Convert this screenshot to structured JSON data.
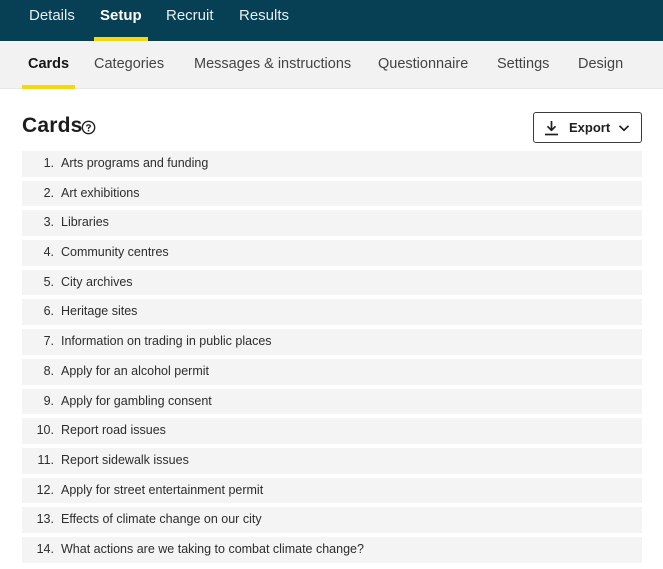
{
  "top_nav": {
    "tabs": [
      {
        "label": "Details"
      },
      {
        "label": "Setup"
      },
      {
        "label": "Recruit"
      },
      {
        "label": "Results"
      }
    ],
    "active": "Setup"
  },
  "sub_nav": {
    "tabs": [
      {
        "label": "Cards"
      },
      {
        "label": "Categories"
      },
      {
        "label": "Messages & instructions"
      },
      {
        "label": "Questionnaire"
      },
      {
        "label": "Settings"
      },
      {
        "label": "Design"
      }
    ],
    "active": "Cards"
  },
  "page": {
    "title": "Cards",
    "export_label": "Export"
  },
  "cards": [
    {
      "num": "1.",
      "text": "Arts programs and funding"
    },
    {
      "num": "2.",
      "text": "Art exhibitions"
    },
    {
      "num": "3.",
      "text": "Libraries"
    },
    {
      "num": "4.",
      "text": "Community centres"
    },
    {
      "num": "5.",
      "text": "City archives"
    },
    {
      "num": "6.",
      "text": "Heritage sites"
    },
    {
      "num": "7.",
      "text": "Information on trading in public places"
    },
    {
      "num": "8.",
      "text": "Apply for an alcohol permit"
    },
    {
      "num": "9.",
      "text": "Apply for gambling consent"
    },
    {
      "num": "10.",
      "text": "Report road issues"
    },
    {
      "num": "11.",
      "text": "Report sidewalk issues"
    },
    {
      "num": "12.",
      "text": "Apply for street entertainment permit"
    },
    {
      "num": "13.",
      "text": "Effects of climate change on our city"
    },
    {
      "num": "14.",
      "text": "What actions are we taking to combat climate change?"
    }
  ],
  "colors": {
    "top_nav_bg": "#073f55",
    "accent": "#f5d90a",
    "sub_nav_bg": "#f2f2f3",
    "row_bg": "#f4f4f4"
  },
  "icons": {
    "help": "help-circle-icon",
    "download": "download-icon",
    "chevron": "chevron-down-icon"
  }
}
